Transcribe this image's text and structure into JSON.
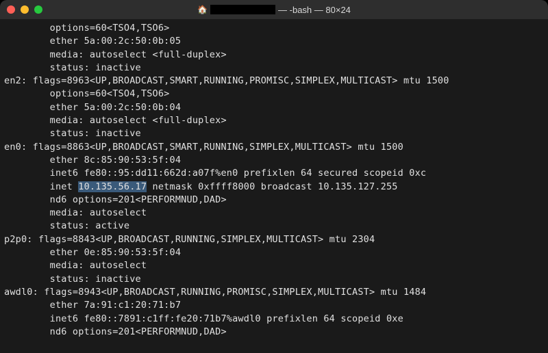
{
  "titlebar": {
    "title_suffix": " — -bash — 80×24"
  },
  "lines": {
    "l1": "        options=60<TSO4,TSO6>",
    "l2": "        ether 5a:00:2c:50:0b:05",
    "l3": "        media: autoselect <full-duplex>",
    "l4": "        status: inactive",
    "l5": "en2: flags=8963<UP,BROADCAST,SMART,RUNNING,PROMISC,SIMPLEX,MULTICAST> mtu 1500",
    "l6": "        options=60<TSO4,TSO6>",
    "l7": "        ether 5a:00:2c:50:0b:04",
    "l8": "        media: autoselect <full-duplex>",
    "l9": "        status: inactive",
    "l10": "en0: flags=8863<UP,BROADCAST,SMART,RUNNING,SIMPLEX,MULTICAST> mtu 1500",
    "l11": "        ether 8c:85:90:53:5f:04",
    "l12": "        inet6 fe80::95:dd11:662d:a07f%en0 prefixlen 64 secured scopeid 0xc",
    "l13_pre": "        inet ",
    "l13_hl": "10.135.56.17",
    "l13_post": " netmask 0xffff8000 broadcast 10.135.127.255",
    "l14": "        nd6 options=201<PERFORMNUD,DAD>",
    "l15": "        media: autoselect",
    "l16": "        status: active",
    "l17": "p2p0: flags=8843<UP,BROADCAST,RUNNING,SIMPLEX,MULTICAST> mtu 2304",
    "l18": "        ether 0e:85:90:53:5f:04",
    "l19": "        media: autoselect",
    "l20": "        status: inactive",
    "l21": "awdl0: flags=8943<UP,BROADCAST,RUNNING,PROMISC,SIMPLEX,MULTICAST> mtu 1484",
    "l22": "        ether 7a:91:c1:20:71:b7",
    "l23": "        inet6 fe80::7891:c1ff:fe20:71b7%awdl0 prefixlen 64 scopeid 0xe",
    "l24": "        nd6 options=201<PERFORMNUD,DAD>"
  }
}
